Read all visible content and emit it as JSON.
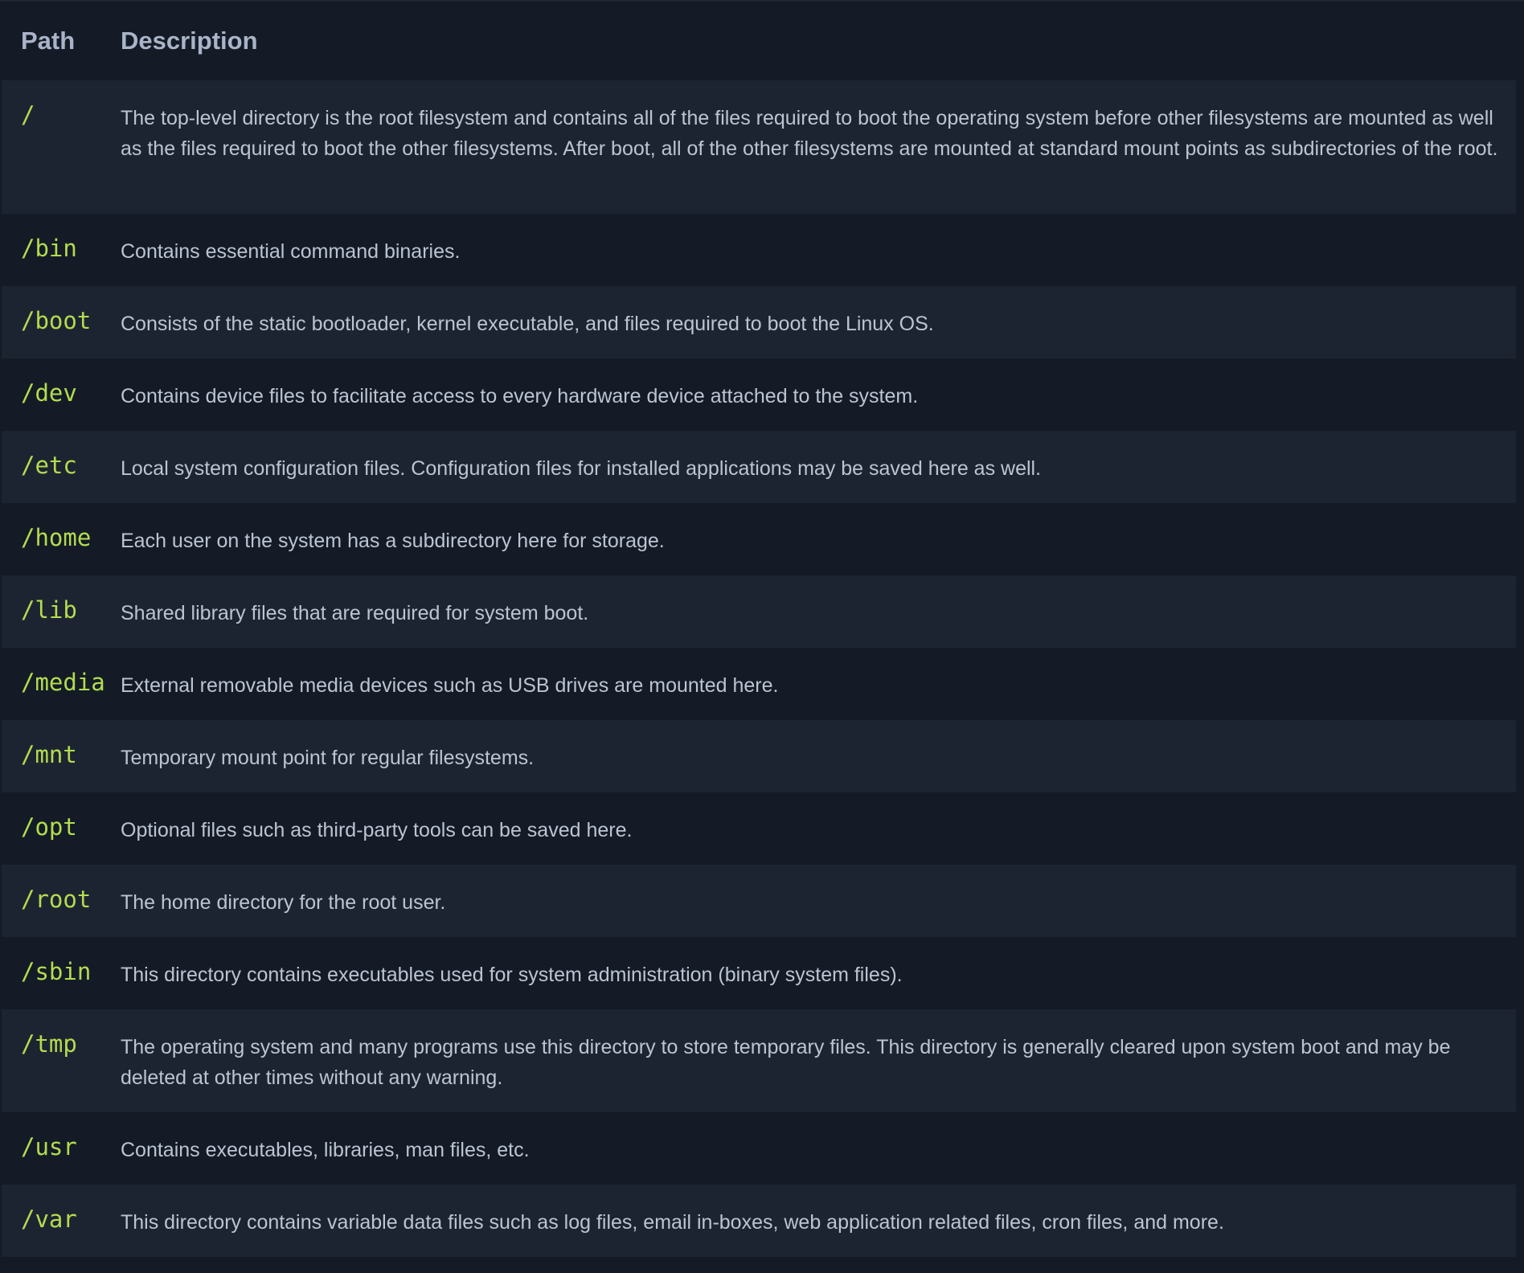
{
  "table": {
    "headers": {
      "path": "Path",
      "description": "Description"
    },
    "rows": [
      {
        "path": "/",
        "description": "The top-level directory is the root filesystem and contains all of the files required to boot the operating system before other filesystems are mounted as well as the files required to boot the other filesystems. After boot, all of the other filesystems are mounted at standard mount points as subdirectories of the root."
      },
      {
        "path": "/bin",
        "description": "Contains essential command binaries."
      },
      {
        "path": "/boot",
        "description": "Consists of the static bootloader, kernel executable, and files required to boot the Linux OS."
      },
      {
        "path": "/dev",
        "description": "Contains device files to facilitate access to every hardware device attached to the system."
      },
      {
        "path": "/etc",
        "description": "Local system configuration files. Configuration files for installed applications may be saved here as well."
      },
      {
        "path": "/home",
        "description": "Each user on the system has a subdirectory here for storage."
      },
      {
        "path": "/lib",
        "description": "Shared library files that are required for system boot."
      },
      {
        "path": "/media",
        "description": "External removable media devices such as USB drives are mounted here."
      },
      {
        "path": "/mnt",
        "description": "Temporary mount point for regular filesystems."
      },
      {
        "path": "/opt",
        "description": "Optional files such as third-party tools can be saved here."
      },
      {
        "path": "/root",
        "description": "The home directory for the root user."
      },
      {
        "path": "/sbin",
        "description": "This directory contains executables used for system administration (binary system files)."
      },
      {
        "path": "/tmp",
        "description": "The operating system and many programs use this directory to store temporary files. This directory is generally cleared upon system boot and may be deleted at other times without any warning."
      },
      {
        "path": "/usr",
        "description": "Contains executables, libraries, man files, etc."
      },
      {
        "path": "/var",
        "description": "This directory contains variable data files such as log files, email in-boxes, web application related files, cron files, and more."
      }
    ]
  },
  "colors": {
    "background": "#141b26",
    "stripe": "#1d2431",
    "path_text": "#b3dc4f",
    "header_text": "#a9b4c9",
    "body_text": "#bcc4d3"
  }
}
